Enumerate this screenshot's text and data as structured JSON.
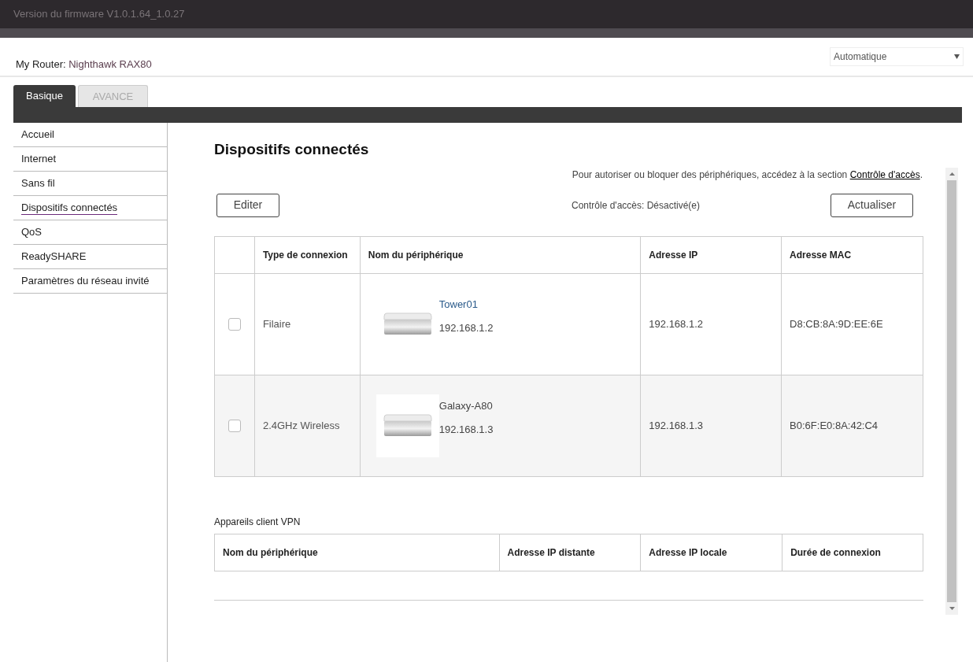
{
  "firmware": "Version du firmware V1.0.1.64_1.0.27",
  "router": {
    "label": "My Router:",
    "name": "Nighthawk RAX80"
  },
  "language_select": {
    "value": "Automatique"
  },
  "tabs": [
    {
      "label": "Basique",
      "selected": true
    },
    {
      "label": "AVANCE",
      "selected": false
    }
  ],
  "sidebar": {
    "items": [
      {
        "label": "Accueil",
        "selected": false
      },
      {
        "label": "Internet",
        "selected": false
      },
      {
        "label": "Sans fil",
        "selected": false
      },
      {
        "label": "Dispositifs connectés",
        "selected": true
      },
      {
        "label": "QoS",
        "selected": false
      },
      {
        "label": "ReadySHARE",
        "selected": false
      },
      {
        "label": "Paramètres du réseau invité",
        "selected": false
      }
    ]
  },
  "page_title": "Dispositifs connectés",
  "access_hint": {
    "text": "Pour autoriser ou bloquer des périphériques, accédez à la section ",
    "link": "Contrôle d'accès",
    "end": "."
  },
  "edit_button": "Editer",
  "access_status": "Contrôle d'accès: Désactivé(e)",
  "refresh_button": "Actualiser",
  "devices_table": {
    "columns": [
      "Type de connexion",
      "Nom du périphérique",
      "Adresse IP",
      "Adresse MAC"
    ],
    "rows": [
      {
        "checked": false,
        "connection": "Filaire",
        "name": "Tower01",
        "device_ip": "192.168.1.2",
        "ip": "192.168.1.2",
        "mac": "D8:CB:8A:9D:EE:6E"
      },
      {
        "checked": false,
        "connection": "2.4GHz Wireless",
        "name": "Galaxy-A80",
        "device_ip": "192.168.1.3",
        "ip": "192.168.1.3",
        "mac": "B0:6F:E0:8A:42:C4"
      }
    ]
  },
  "vpn_table": {
    "title": "Appareils client VPN",
    "columns": [
      "Nom du périphérique",
      "Adresse IP distante",
      "Adresse IP locale",
      "Durée de connexion"
    ]
  }
}
